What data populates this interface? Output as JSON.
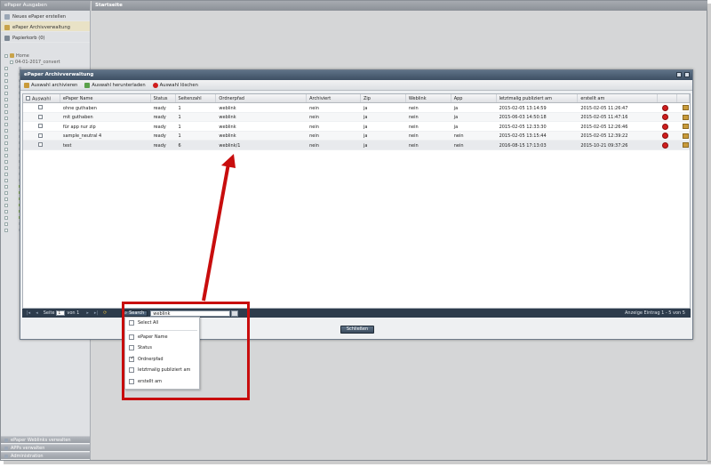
{
  "sidebar": {
    "header": "ePaper Ausgaben",
    "items": [
      {
        "label": "Neues ePaper erstellen",
        "icon": "document-icon"
      },
      {
        "label": "ePaper Archivverwaltung",
        "icon": "archive-icon"
      },
      {
        "label": "Papierkorb (0)",
        "icon": "trash-icon"
      }
    ],
    "tree": {
      "root": "Home",
      "first_child": "04-01-2017_convert"
    },
    "bottom": [
      {
        "label": "ePaper Weblinks verwalten"
      },
      {
        "label": "APPs verwalten"
      },
      {
        "label": "Administration"
      }
    ]
  },
  "main": {
    "title": "Startseite"
  },
  "window": {
    "title": "ePaper Archivverwaltung",
    "toolbar": {
      "archive": "Auswahl archivieren",
      "download": "Auswahl herunterladen",
      "delete": "Auswahl löschen"
    },
    "columns": [
      "Auswahl",
      "ePaper Name",
      "Status",
      "Seitenzahl",
      "Ordnerpfad",
      "Archiviert",
      "Zip",
      "Weblink",
      "App",
      "letztmalig publiziert am",
      "erstellt am",
      "",
      ""
    ],
    "rows": [
      {
        "name": "ohne guthaben",
        "status": "ready",
        "pages": "1",
        "path": "weblink",
        "archived": "nein",
        "zip": "ja",
        "weblink": "nein",
        "app": "ja",
        "published": "2015-02-05 13:14:59",
        "created": "2015-02-05 11:26:47"
      },
      {
        "name": "mit guthaben",
        "status": "ready",
        "pages": "1",
        "path": "weblink",
        "archived": "nein",
        "zip": "ja",
        "weblink": "nein",
        "app": "ja",
        "published": "2015-06-03 14:50:18",
        "created": "2015-02-05 11:47:16"
      },
      {
        "name": "für app nur zip",
        "status": "ready",
        "pages": "1",
        "path": "weblink",
        "archived": "nein",
        "zip": "ja",
        "weblink": "nein",
        "app": "ja",
        "published": "2015-02-05 12:33:30",
        "created": "2015-02-05 12:26:46"
      },
      {
        "name": "sample_neutral 4",
        "status": "ready",
        "pages": "1",
        "path": "weblink",
        "archived": "nein",
        "zip": "ja",
        "weblink": "nein",
        "app": "nein",
        "published": "2015-02-05 13:15:44",
        "created": "2015-02-05 12:39:22"
      },
      {
        "name": "test",
        "status": "ready",
        "pages": "6",
        "path": "weblink/1",
        "archived": "nein",
        "zip": "ja",
        "weblink": "nein",
        "app": "nein",
        "published": "2016-08-15 17:13:03",
        "created": "2015-10-21 09:37:26"
      }
    ],
    "pager": {
      "page_label": "Seite",
      "page_value": "1",
      "of_label": "von 1",
      "search_label": "Search",
      "search_value": "weblink",
      "info": "Anzeige Eintrag 1 - 5 von 5"
    },
    "close_label": "Schließen"
  },
  "dropdown": {
    "select_all": "Select All",
    "options": [
      {
        "label": "ePaper Name",
        "checked": false
      },
      {
        "label": "Status",
        "checked": false
      },
      {
        "label": "Ordnerpfad",
        "checked": true
      },
      {
        "label": "letztmalig publiziert am",
        "checked": false
      },
      {
        "label": "erstellt am",
        "checked": false
      }
    ]
  },
  "colors": {
    "annotation": "#c80d0d",
    "titlebar": "#3d4f63",
    "pager": "#2d3c4c"
  }
}
